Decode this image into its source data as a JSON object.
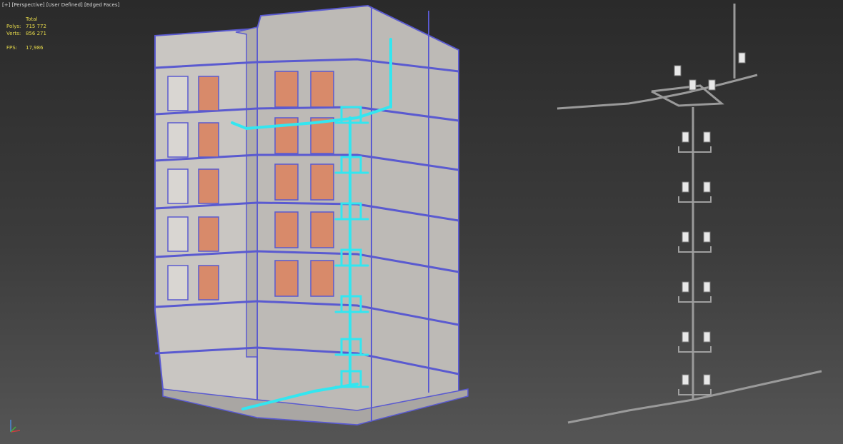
{
  "viewport": {
    "menu_plus": "[+]",
    "view": "[Perspective]",
    "shading": "[User Defined]",
    "mode": "[Edged Faces]"
  },
  "stats": {
    "header": "Total",
    "polys_label": "Polys:",
    "polys": "715 772",
    "verts_label": "Verts:",
    "verts": "856 271",
    "fps_label": "FPS:",
    "fps": "17,986"
  },
  "colors": {
    "pipe_selected": "#33e6f0",
    "pipe_unselected": "#a0a0a0",
    "wall_edges": "#5a5ad0",
    "wall_fill": "#c9c6c2",
    "window_fill": "#d88a6a",
    "stats_text": "#e6d94a"
  }
}
